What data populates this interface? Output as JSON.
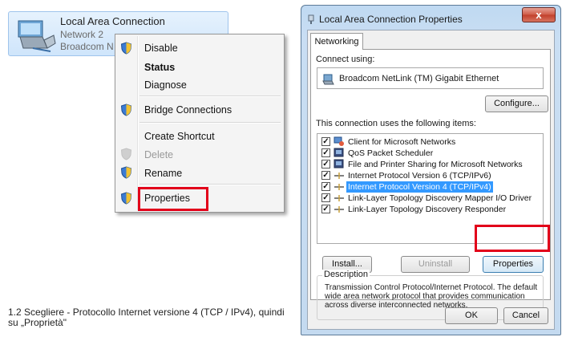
{
  "connection": {
    "title": "Local Area Connection",
    "network": "Network  2",
    "adapter": "Broadcom N"
  },
  "context_menu": {
    "items": [
      {
        "label": "Disable",
        "shield": true,
        "bold": false,
        "disabled": false
      },
      {
        "label": "Status",
        "shield": false,
        "bold": true,
        "disabled": false
      },
      {
        "label": "Diagnose",
        "shield": false,
        "bold": false,
        "disabled": false
      },
      {
        "label": "Bridge Connections",
        "shield": true,
        "bold": false,
        "disabled": false
      },
      {
        "label": "Create Shortcut",
        "shield": false,
        "bold": false,
        "disabled": false
      },
      {
        "label": "Delete",
        "shield": true,
        "bold": false,
        "disabled": true
      },
      {
        "label": "Rename",
        "shield": true,
        "bold": false,
        "disabled": false
      },
      {
        "label": "Properties",
        "shield": true,
        "bold": false,
        "disabled": false
      }
    ],
    "highlighted": "Properties"
  },
  "caption": "1.2 Scegliere - Protocollo Internet versione 4 (TCP / IPv4), quindi su „Proprietà\"",
  "dialog": {
    "title": "Local Area Connection Properties",
    "close_label": "x",
    "tab": "Networking",
    "connect_using_label": "Connect using:",
    "adapter_name": "Broadcom NetLink (TM) Gigabit Ethernet",
    "configure_label": "Configure...",
    "items_label": "This connection uses the following items:",
    "items": [
      {
        "label": "Client for Microsoft Networks",
        "checked": true,
        "selected": false,
        "icon": "client-icon"
      },
      {
        "label": "QoS Packet Scheduler",
        "checked": true,
        "selected": false,
        "icon": "scheduler-icon"
      },
      {
        "label": "File and Printer Sharing for Microsoft Networks",
        "checked": true,
        "selected": false,
        "icon": "sharing-icon"
      },
      {
        "label": "Internet Protocol Version 6 (TCP/IPv6)",
        "checked": true,
        "selected": false,
        "icon": "protocol-icon"
      },
      {
        "label": "Internet Protocol Version 4 (TCP/IPv4)",
        "checked": true,
        "selected": true,
        "icon": "protocol-icon"
      },
      {
        "label": "Link-Layer Topology Discovery Mapper I/O Driver",
        "checked": true,
        "selected": false,
        "icon": "protocol-icon"
      },
      {
        "label": "Link-Layer Topology Discovery Responder",
        "checked": true,
        "selected": false,
        "icon": "protocol-icon"
      }
    ],
    "install_label": "Install...",
    "uninstall_label": "Uninstall",
    "properties_label": "Properties",
    "description_legend": "Description",
    "description_text": "Transmission Control Protocol/Internet Protocol. The default wide area network protocol that provides communication across diverse interconnected networks.",
    "ok_label": "OK",
    "cancel_label": "Cancel"
  },
  "colors": {
    "highlight_box": "#e2001a",
    "selection": "#3399ff"
  }
}
